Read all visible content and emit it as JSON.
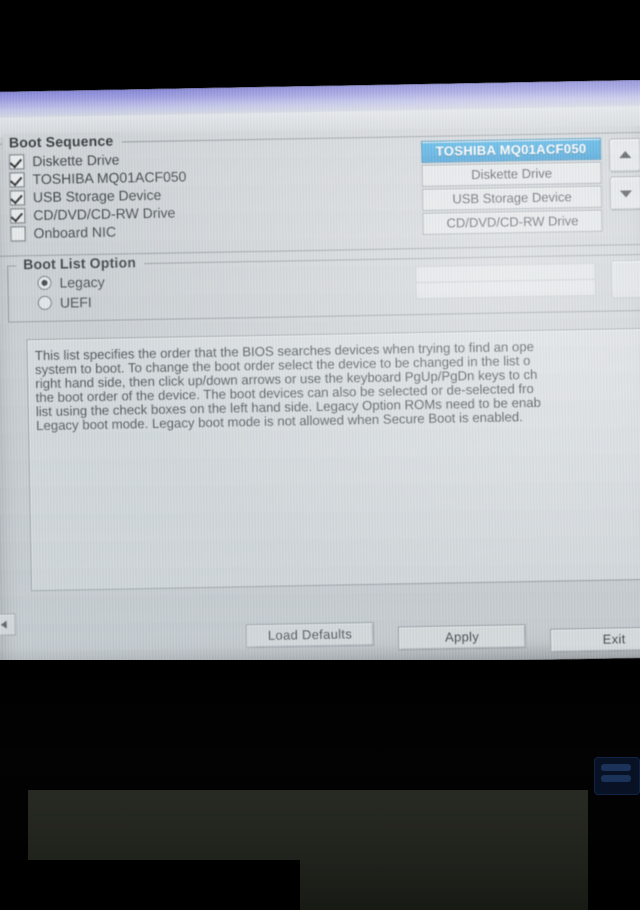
{
  "screen": {
    "boot_sequence": {
      "legend": "Boot Sequence",
      "devices": [
        {
          "label": "Diskette Drive",
          "checked": true
        },
        {
          "label": "TOSHIBA MQ01ACF050",
          "checked": true
        },
        {
          "label": "USB Storage Device",
          "checked": true
        },
        {
          "label": "CD/DVD/CD-RW Drive",
          "checked": true
        },
        {
          "label": "Onboard NIC",
          "checked": false
        }
      ],
      "order_list": [
        {
          "label": "TOSHIBA MQ01ACF050",
          "selected": true
        },
        {
          "label": "Diskette Drive",
          "selected": false
        },
        {
          "label": "USB Storage Device",
          "selected": false
        },
        {
          "label": "CD/DVD/CD-RW Drive",
          "selected": false
        }
      ],
      "move_up_icon": "arrow-up-icon",
      "move_down_icon": "arrow-down-icon"
    },
    "boot_list_option": {
      "legend": "Boot List Option",
      "options": [
        {
          "label": "Legacy",
          "selected": true
        },
        {
          "label": "UEFI",
          "selected": false
        }
      ]
    },
    "description": {
      "lines": [
        "This list specifies the order that the BIOS searches devices when trying to find an ope",
        "system to boot. To change the boot order select the device to be changed in the list o",
        "right hand side, then click up/down arrows or use the keyboard PgUp/PgDn keys to ch",
        "the boot order of the device. The boot devices can also be selected or de-selected fro",
        "list using the check boxes on the left hand side. Legacy Option ROMs need to be enab",
        "Legacy boot mode. Legacy boot mode is not allowed when Secure Boot is enabled."
      ]
    },
    "actions": {
      "load_defaults": "Load Defaults",
      "apply": "Apply",
      "exit": "Exit"
    },
    "colors": {
      "selection_blue": "#0c86cf",
      "panel_grey": "#c9ced2",
      "header_violet": "#8a8ada"
    }
  }
}
